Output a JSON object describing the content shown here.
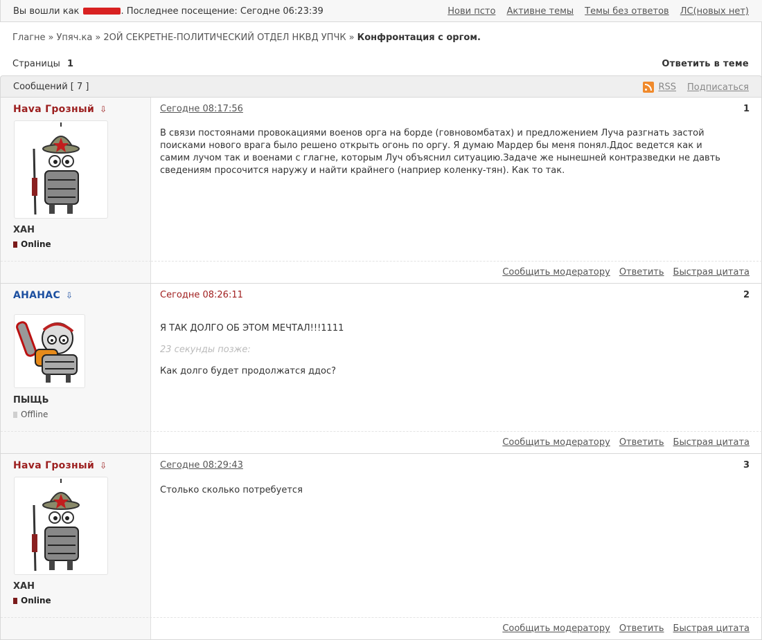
{
  "topbar": {
    "welcome_prefix": "Вы вошли как",
    "welcome_suffix": ". Последнее посещение: Сегодне 06:23:39",
    "links": [
      "Нови псто",
      "Активне темы",
      "Темы без ответов",
      "ЛС(новых нет)"
    ]
  },
  "breadcrumb": {
    "items": [
      "Глагне",
      "Упяч.ка",
      "2ОЙ СЕКРЕТНЕ-ПОЛИТИЧЕСКИЙ ОТДЕЛ НКВД УПЧК"
    ],
    "separator": "»",
    "current": "Конфронтация с оргом."
  },
  "pages": {
    "label": "Страницы",
    "current": "1"
  },
  "reply_topic": "Ответить в теме",
  "posts_header": {
    "title": "Сообщений",
    "count": "[ 7 ]",
    "rss": "RSS",
    "subscribe": "Подписаться"
  },
  "post_actions": {
    "report": "Сообщить модератору",
    "reply": "Ответить",
    "quote": "Быстрая цитата"
  },
  "posts": [
    {
      "author": "Hava Грозный",
      "arrow": "⇩",
      "rank": "ХАН",
      "status": "Online",
      "date": "Сегодне 08:17:56",
      "number": "1",
      "message": "В связи постоянами провокациями военов орга на борде (говновомбатах) и предложением Луча разгнать застой поисками нового врага было решено открыть огонь по оргу. Я думаю Мардер бы меня понял.Ддос ведется как и самим лучом так и военами с глагне, которым Луч объяснил ситуацию.Задаче же нынешней контразведки не давть сведениям просочится наружу и найти крайнего (наприер коленку-тян). Как то так."
    },
    {
      "author": "АНАНАС",
      "arrow": "⇩",
      "rank": "ПЫЩЬ",
      "status": "Offline",
      "date": "Сегодне 08:26:11",
      "number": "2",
      "message": "Я ТАК ДОЛГО ОБ ЭТОМ МЕЧТАЛ!!!1111",
      "later": "23 секунды позже:",
      "message2": "Как долго будет продолжатся ддос?"
    },
    {
      "author": "Hava Грозный",
      "arrow": "⇩",
      "rank": "ХАН",
      "status": "Online",
      "date": "Сегодне 08:29:43",
      "number": "3",
      "message": "Столько сколько потребуется"
    }
  ],
  "colors": {
    "author_red": "#9c1f1f",
    "author_blue": "#1c4fa0",
    "rss_orange": "#f08a2c"
  }
}
